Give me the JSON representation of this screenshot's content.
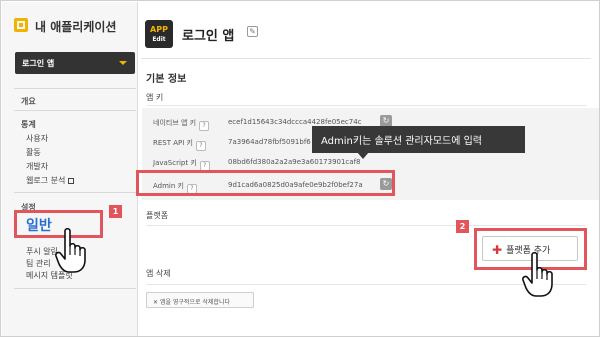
{
  "sidebar": {
    "app_name": "내 애플리케이션",
    "selected_app": "로그인 앱",
    "overview": "개요",
    "stats_heading": "통계",
    "stats_items": [
      "사용자",
      "활동",
      "개발자",
      "웹로그 분석"
    ],
    "settings_heading": "설정",
    "settings_active": "일반",
    "settings_items": [
      "푸시 알림",
      "팀 관리",
      "메시지 템플릿"
    ]
  },
  "header": {
    "badge_top": "APP",
    "badge_bottom": "Edit",
    "title": "로그인 앱",
    "edit_icon": "pencil-icon"
  },
  "main": {
    "section_title": "기본 정보",
    "app_keys_title": "앱 키",
    "keys": [
      {
        "label": "네이티브 앱 키",
        "value": "ecef1d15643c34dccca4428fe05ec74c"
      },
      {
        "label": "REST API 키",
        "value": "7a3964ad78fbf5091bf6"
      },
      {
        "label": "JavaScript 키",
        "value": "08bd6fd380a2a2a9e3a60173901caf8"
      },
      {
        "label": "Admin 키",
        "value": "9d1cad6a0825d0a9afe0e9b2f0bef27a"
      }
    ],
    "tooltip": "Admin키는 솔루션 관리자모드에 입력",
    "platform_title": "플랫폼",
    "add_platform_label": "플랫폼 추가",
    "delete_title": "앱 삭제",
    "delete_button": "앱을 영구적으로 삭제합니다"
  },
  "annotations": {
    "step1": "1",
    "step2": "2"
  },
  "colors": {
    "highlight": "#e2555a",
    "accent": "#f0b400",
    "active_link": "#2a6fd0"
  }
}
